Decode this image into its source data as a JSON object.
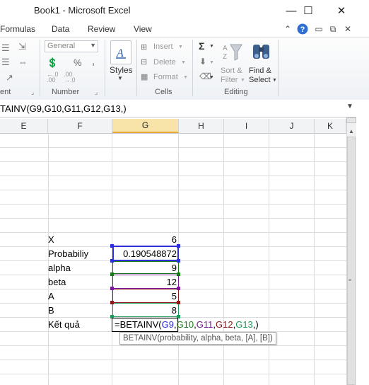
{
  "window": {
    "title": "Book1  -  Microsoft Excel",
    "minimize_glyph": "—",
    "maximize_glyph": "☐",
    "close_glyph": "✕"
  },
  "tabs": [
    "Formulas",
    "Data",
    "Review",
    "View"
  ],
  "tab_icons": [
    "chevron-up-icon",
    "help-icon",
    "minimize-doc-icon",
    "restore-doc-icon",
    "close-doc-icon"
  ],
  "ribbon": {
    "alignment_label": "ent",
    "number_label": "Number",
    "number_format": "General",
    "percent_symbol": "%",
    "comma_symbol": ",",
    "styles_label": "Styles",
    "cells_label": "Cells",
    "insert_label": "Insert",
    "delete_label": "Delete",
    "format_label": "Format",
    "editing_label": "Editing",
    "sigma_symbol": "Σ",
    "sort_filter_label_1": "Sort &",
    "sort_filter_label_2": "Filter",
    "find_select_label_1": "Find &",
    "find_select_label_2": "Select"
  },
  "formula_bar": {
    "text": "TAINV(G9,G10,G11,G12,G13,)"
  },
  "columns": [
    "E",
    "F",
    "G",
    "H",
    "I",
    "J",
    "K"
  ],
  "selected_column": "G",
  "rows": [
    {
      "label": "X",
      "value": "6"
    },
    {
      "label": "Probabiliy",
      "value": "0.190548872"
    },
    {
      "label": "alpha",
      "value": "9"
    },
    {
      "label": "beta",
      "value": "12"
    },
    {
      "label": "A",
      "value": "5"
    },
    {
      "label": "B",
      "value": "8"
    }
  ],
  "result_label": "Kết quả",
  "edit_formula": {
    "prefix": "=BETAINV(",
    "arg1": "G9",
    "sep1": ",",
    "arg2": "G10",
    "sep2": ",",
    "arg3": "G11",
    "sep3": ",",
    "arg4": "G12",
    "sep4": ",",
    "arg5": "G13",
    "suffix": ",)"
  },
  "tooltip": "BETAINV(probability, alpha, beta, [A], [B])",
  "colors": {
    "ref1": "#2d2fd6",
    "ref2": "#1a7a1a",
    "ref3": "#7a1a9a",
    "ref4": "#8b1a1a",
    "ref5": "#1e9a5a",
    "selected_header": "#f8e3a8"
  }
}
